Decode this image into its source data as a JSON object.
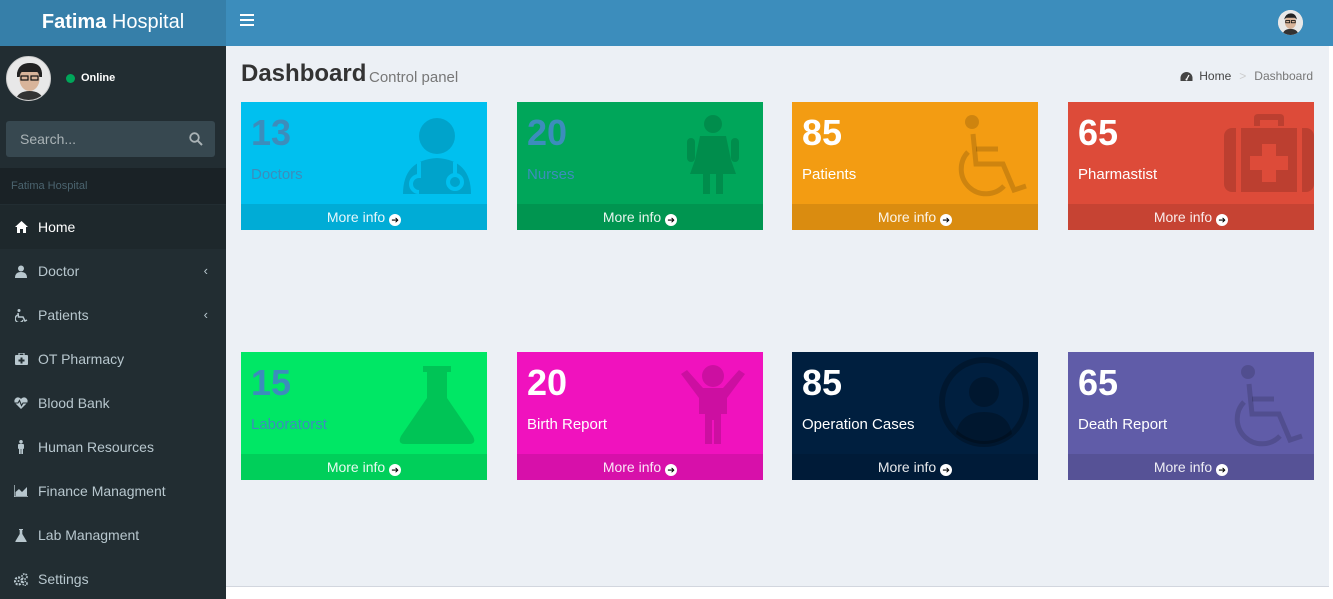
{
  "app": {
    "logo_bold": "Fatima",
    "logo_rest": " Hospital"
  },
  "user": {
    "status": "Online"
  },
  "search": {
    "placeholder": "Search..."
  },
  "sidebar": {
    "header": "Fatima Hospital",
    "items": [
      {
        "label": "Home",
        "icon": "home-icon",
        "active": true
      },
      {
        "label": "Doctor",
        "icon": "doctor-icon",
        "caret": true
      },
      {
        "label": "Patients",
        "icon": "wheelchair-icon",
        "caret": true
      },
      {
        "label": "OT Pharmacy",
        "icon": "medkit-icon"
      },
      {
        "label": "Blood Bank",
        "icon": "heartbeat-icon"
      },
      {
        "label": "Human Resources",
        "icon": "person-icon"
      },
      {
        "label": "Finance Managment",
        "icon": "area-chart-icon"
      },
      {
        "label": "Lab Managment",
        "icon": "flask-icon"
      },
      {
        "label": "Settings",
        "icon": "gears-icon"
      }
    ]
  },
  "content": {
    "title": "Dashboard",
    "subtitle": "Control panel"
  },
  "breadcrumb": {
    "home": "Home",
    "current": "Dashboard"
  },
  "boxes": [
    {
      "number": "13",
      "label": "Doctors",
      "more": "More info",
      "color": "#00c0ef",
      "icon": "doctor-icon"
    },
    {
      "number": "20",
      "label": "Nurses",
      "more": "More info",
      "color": "#00a65a",
      "icon": "female-icon"
    },
    {
      "number": "85",
      "label": "Patients",
      "more": "More info",
      "color": "#f39c12",
      "icon": "wheelchair-icon"
    },
    {
      "number": "65",
      "label": "Pharmastist",
      "more": "More info",
      "color": "#dd4b39",
      "icon": "medkit-icon"
    },
    {
      "number": "15",
      "label": "Laboratorst",
      "more": "More info",
      "color": "#00e765",
      "icon": "flask-icon"
    },
    {
      "number": "20",
      "label": "Birth Report",
      "more": "More info",
      "color": "#f012be",
      "icon": "child-icon"
    },
    {
      "number": "85",
      "label": "Operation Cases",
      "more": "More info",
      "color": "#001f3f",
      "icon": "user-circle-icon"
    },
    {
      "number": "65",
      "label": "Death Report",
      "more": "More info",
      "color": "#605ca8",
      "icon": "wheelchair-icon"
    }
  ]
}
